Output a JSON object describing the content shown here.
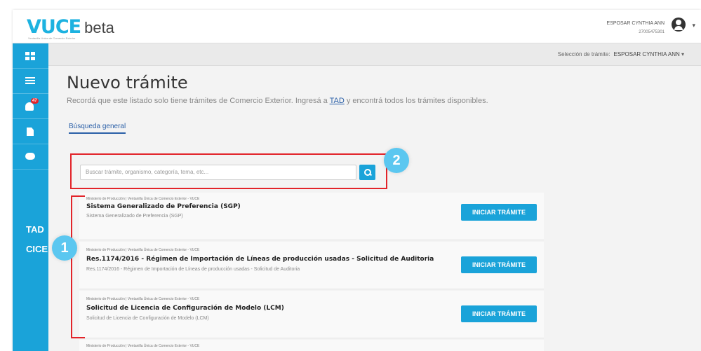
{
  "header": {
    "logo_brand": "VUCE",
    "logo_suffix": "beta",
    "logo_tagline": "Ventanilla Unica de Comercio Exterior",
    "user_name": "ESPOSAR CYNTHIA ANN",
    "user_cuit": "27005475301"
  },
  "sidebar": {
    "items": [
      {
        "icon": "grid-icon"
      },
      {
        "icon": "list-icon"
      },
      {
        "icon": "bell-icon",
        "badge": "47"
      },
      {
        "icon": "document-icon"
      },
      {
        "icon": "chat-icon"
      }
    ],
    "tad_label": "TAD",
    "cice_label": "CICE"
  },
  "subbar": {
    "label": "Selección de trámite:",
    "value": "ESPOSAR CYNTHIA ANN",
    "caret": "▾"
  },
  "main": {
    "title": "Nuevo trámite",
    "subtitle_pre": "Recordá que este listado solo tiene trámites de Comercio Exterior. Ingresá a ",
    "subtitle_link": "TAD",
    "subtitle_post": " y encontrá todos los trámites disponibles.",
    "tab_label": "Búsqueda general",
    "search_placeholder": "Buscar trámite, organismo, categoría, tema, etc..."
  },
  "annotations": {
    "one": "1",
    "two": "2"
  },
  "cards": [
    {
      "org": "Ministerio de Producción | Ventanilla Única de Comercio Exterior - VUCE",
      "title": "Sistema Generalizado de Preferencia (SGP)",
      "desc": "Sistema Generalizado de Preferencia (SGP)",
      "button": "INICIAR TRÁMITE"
    },
    {
      "org": "Ministerio de Producción | Ventanilla Única de Comercio Exterior - VUCE",
      "title": "Res.1174/2016 - Régimen de Importación de Líneas de producción usadas - Solicitud de Auditoria",
      "desc": "Res.1174/2016 - Régimen de Importación de Líneas de producción usadas - Solicitud de Auditoria",
      "button": "INICIAR TRÁMITE"
    },
    {
      "org": "Ministerio de Producción | Ventanilla Única de Comercio Exterior - VUCE",
      "title": "Solicitud de Licencia de Configuración de Modelo (LCM)",
      "desc": "Solicitud de Licencia de Configuración de Modelo (LCM)",
      "button": "INICIAR TRÁMITE"
    },
    {
      "org": "Ministerio de Producción | Ventanilla Única de Comercio Exterior - VUCE"
    }
  ],
  "colors": {
    "accent": "#1aa3d9",
    "brand": "#2a5fa7",
    "highlight": "#e2242a",
    "annotation": "#5bc7f0"
  }
}
